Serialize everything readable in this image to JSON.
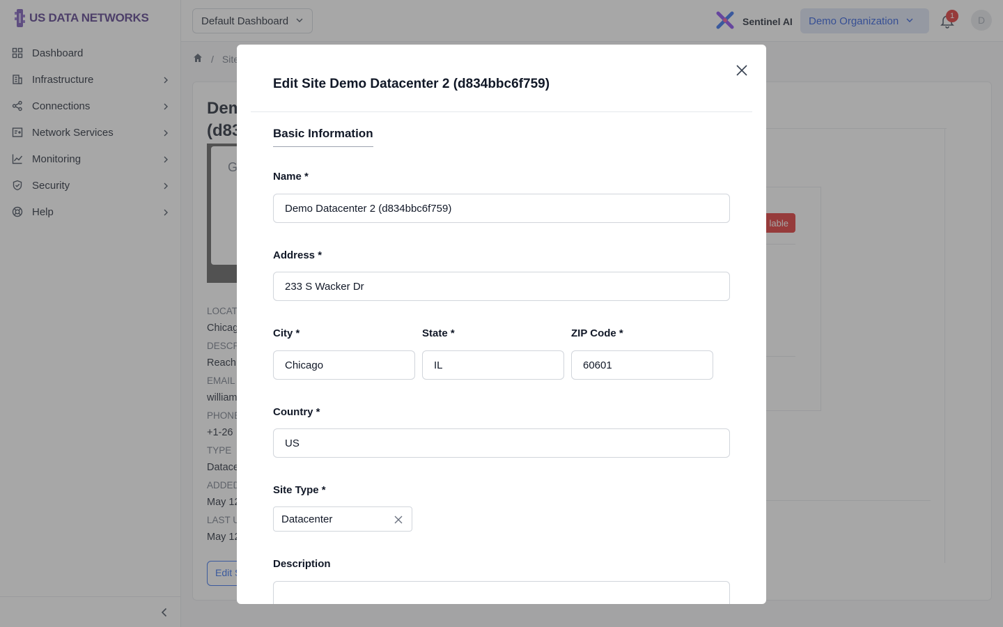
{
  "sidebar": {
    "logo_text": "US DATA NETWORKS",
    "items": [
      {
        "label": "Dashboard",
        "icon": "grid-icon"
      },
      {
        "label": "Infrastructure",
        "icon": "building-icon"
      },
      {
        "label": "Connections",
        "icon": "share-icon"
      },
      {
        "label": "Network Services",
        "icon": "server-icon"
      },
      {
        "label": "Monitoring",
        "icon": "chart-line-icon"
      },
      {
        "label": "Security",
        "icon": "shield-icon"
      },
      {
        "label": "Help",
        "icon": "lifebuoy-icon"
      }
    ]
  },
  "header": {
    "dashboard_select": "Default Dashboard",
    "sentinel_label": "Sentinel AI",
    "org_select": "Demo Organization",
    "notification_count": "1",
    "avatar_initial": "D"
  },
  "background": {
    "crumb_sep": "/",
    "crumb_sites": "Site",
    "site_title_1": "Dem",
    "site_title_2": "(d83",
    "map_popup_letter": "G",
    "info": [
      {
        "key": "LOCAT",
        "value": "Chicag"
      },
      {
        "key": "DESCR",
        "value": "Reach"
      },
      {
        "key": "EMAIL",
        "value": "william"
      },
      {
        "key": "PHONE",
        "value": "+1-26"
      },
      {
        "key": "TYPE",
        "value": "Datace"
      },
      {
        "key": "ADDED",
        "value": "May 12"
      },
      {
        "key": "LAST U",
        "value": "May 12"
      }
    ],
    "edit_button": "Edit S",
    "status_badge": "lable"
  },
  "modal": {
    "title": "Edit Site Demo Datacenter 2 (d834bbc6f759)",
    "tab": "Basic Information",
    "name_label": "Name *",
    "name_value": "Demo Datacenter 2 (d834bbc6f759)",
    "address_label": "Address *",
    "address_value": "233 S Wacker Dr",
    "city_label": "City *",
    "city_value": "Chicago",
    "state_label": "State *",
    "state_value": "IL",
    "zip_label": "ZIP Code *",
    "zip_value": "60601",
    "country_label": "Country *",
    "country_value": "US",
    "site_type_label": "Site Type *",
    "site_type_value": "Datacenter",
    "description_label": "Description"
  },
  "colors": {
    "accent": "#2563eb",
    "brand": "#4b2e83",
    "danger": "#dc2626",
    "org_bg": "#dbe3f4"
  }
}
